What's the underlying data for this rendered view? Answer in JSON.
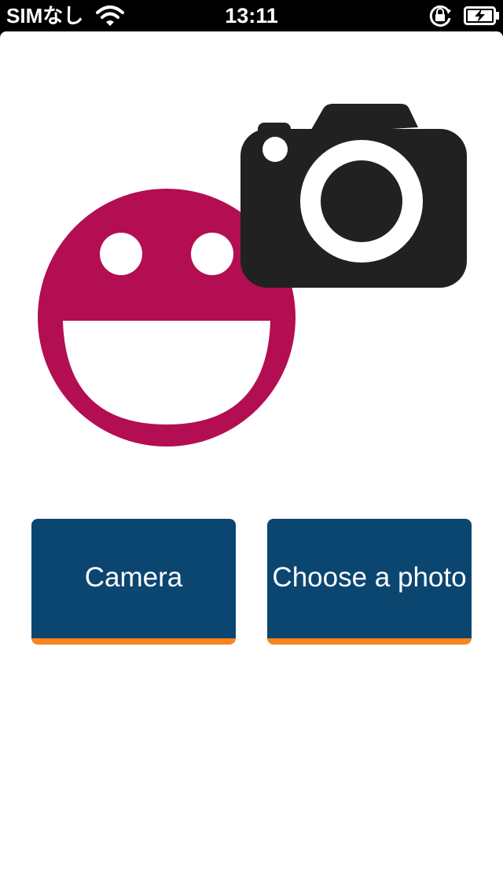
{
  "status_bar": {
    "carrier": "SIMなし",
    "time": "13:11",
    "icons": [
      "wifi-icon",
      "rotation-lock-icon",
      "battery-charging-icon"
    ]
  },
  "hero": {
    "icons": [
      "smiley-face-icon",
      "camera-icon"
    ],
    "colors": {
      "smiley": "#b30e52",
      "camera": "#212121"
    }
  },
  "buttons": {
    "camera_label": "Camera",
    "choose_label": "Choose a photo"
  },
  "colors": {
    "button_background": "#0b4670",
    "button_accent": "#f7861e",
    "background": "#ffffff"
  }
}
